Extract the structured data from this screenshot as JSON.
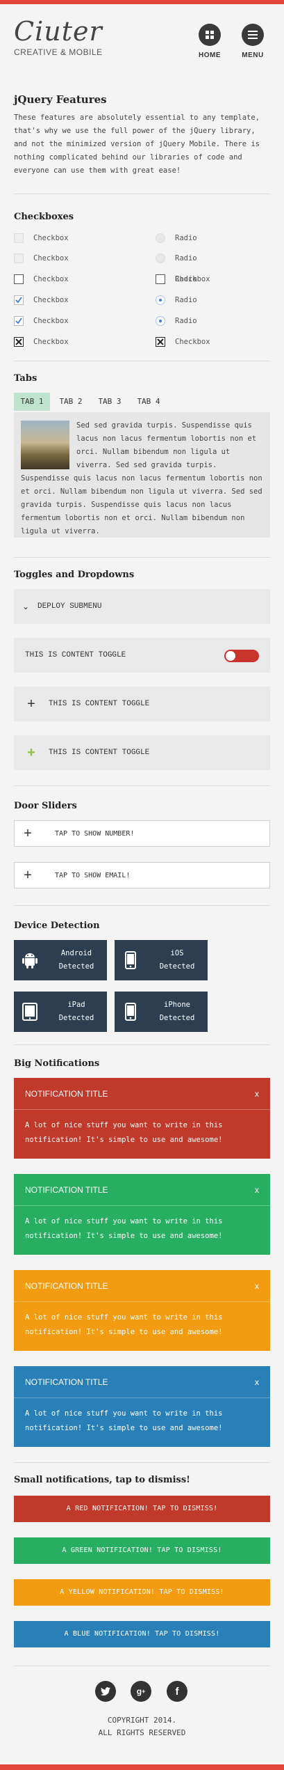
{
  "header": {
    "logo": "Ciuter",
    "tagline": "CREATIVE & MOBILE",
    "home_label": "HOME",
    "menu_label": "MENU"
  },
  "features": {
    "title": "jQuery Features",
    "text": "These features are absolutely essential to any template, that's why we use the full power of the jQuery library, and not the minimized version of jQuery Mobile. There is nothing complicated behind our libraries of code and everyone can use them with great ease!"
  },
  "checkboxes": {
    "title": "Checkboxes",
    "checkbox_label": "Checkbox",
    "radio_label": "Radio"
  },
  "tabs": {
    "title": "Tabs",
    "items": [
      "TAB 1",
      "TAB 2",
      "TAB 3",
      "TAB 4"
    ],
    "active_index": 0,
    "content": "Sed sed gravida turpis. Suspendisse quis lacus non lacus fermentum lobortis non et orci. Nullam bibendum non ligula ut viverra. Sed sed gravida turpis. Suspendisse quis lacus non lacus fermentum lobortis non et orci. Nullam bibendum non ligula ut viverra. Sed sed gravida turpis. Suspendisse quis lacus non lacus fermentum lobortis non et orci. Nullam bibendum non ligula ut viverra."
  },
  "toggles": {
    "title": "Toggles and Dropdowns",
    "deploy": "DEPLOY SUBMENU",
    "content_toggle": "THIS IS CONTENT TOGGLE"
  },
  "door": {
    "title": "Door Sliders",
    "number": "TAP TO SHOW NUMBER!",
    "email": "TAP TO SHOW EMAIL!"
  },
  "devices": {
    "title": "Device Detection",
    "detected": "Detected",
    "items": [
      "Android",
      "iOS",
      "iPad",
      "iPhone"
    ]
  },
  "big_notifications": {
    "title": "Big Notifications",
    "heading": "NOTIFICATION TITLE",
    "close": "x",
    "body": "A lot of nice stuff you want to write in this notification! It's simple to use and awesome!",
    "colors": [
      "#c0392b",
      "#27ae60",
      "#f39c12",
      "#2980b9"
    ]
  },
  "small_notifications": {
    "title": "Small notifications, tap to dismiss!",
    "items": [
      {
        "text": "A RED NOTIFICATION! TAP TO DISMISS!",
        "color": "#c0392b"
      },
      {
        "text": "A GREEN NOTIFICATION! TAP TO DISMISS!",
        "color": "#27ae60"
      },
      {
        "text": "A YELLOW NOTIFICATION! TAP TO DISMISS!",
        "color": "#f39c12"
      },
      {
        "text": "A BLUE NOTIFICATION! TAP TO DISMISS!",
        "color": "#2980b9"
      }
    ]
  },
  "footer": {
    "social": [
      "twitter-icon",
      "google-plus-icon",
      "facebook-icon"
    ],
    "copyright": "COPYRIGHT 2014.",
    "rights": "ALL RIGHTS RESERVED"
  }
}
